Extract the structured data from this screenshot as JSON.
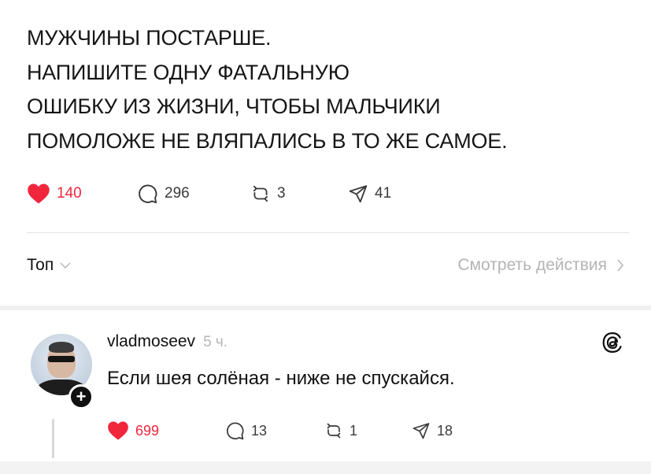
{
  "post": {
    "lines": [
      "МУЖЧИНЫ ПОСТАРШЕ.",
      "НАПИШИТЕ ОДНУ ФАТАЛЬНУЮ",
      "ОШИБКУ ИЗ ЖИЗНИ, ЧТОБЫ МАЛЬЧИКИ",
      "ПОМОЛОЖЕ НЕ ВЛЯПАЛИСЬ В ТО ЖЕ САМОЕ."
    ],
    "stats": {
      "likes": "140",
      "replies": "296",
      "reposts": "3",
      "shares": "41"
    }
  },
  "sort": {
    "label": "Топ",
    "view_activity": "Смотреть действия"
  },
  "comment": {
    "username": "vladmoseev",
    "time": "5 ч.",
    "text": "Если шея солёная - ниже не спускайся.",
    "stats": {
      "likes": "699",
      "replies": "13",
      "reposts": "1",
      "shares": "18"
    }
  },
  "colors": {
    "like": "#f0263d",
    "muted": "#b4b4b4",
    "text": "#111111"
  },
  "icons": [
    "heart-icon",
    "comment-icon",
    "repost-icon",
    "share-icon",
    "chevron-down-icon",
    "chevron-right-icon",
    "threads-logo-icon",
    "plus-icon"
  ]
}
